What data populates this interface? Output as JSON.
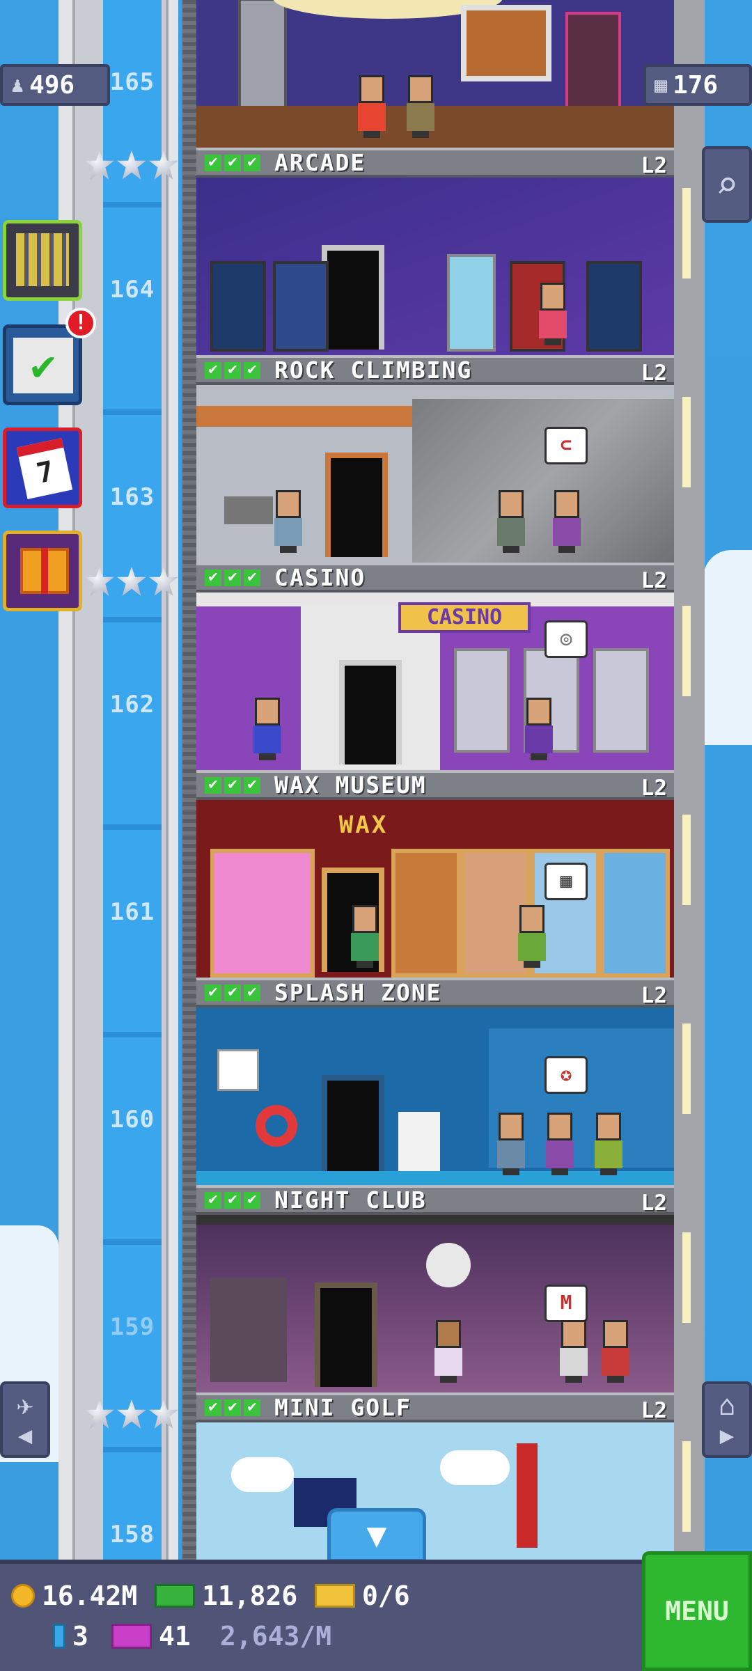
{
  "header": {
    "population": "496",
    "floors_count": "176",
    "population_icon": "person-icon",
    "floors_icon": "building-icon"
  },
  "elevator": {
    "floor_numbers": [
      "165",
      "164",
      "163",
      "162",
      "161",
      "160",
      "159",
      "158"
    ]
  },
  "floors": [
    {
      "name": "ARCADE",
      "level": "L2",
      "stars": 3
    },
    {
      "name": "ROCK CLIMBING",
      "level": "L2",
      "stars": 0
    },
    {
      "name": "CASINO",
      "level": "L2",
      "stars": 3
    },
    {
      "name": "WAX MUSEUM",
      "level": "L2",
      "stars": 0
    },
    {
      "name": "SPLASH ZONE",
      "level": "L2",
      "stars": 0
    },
    {
      "name": "NIGHT CLUB",
      "level": "L2",
      "stars": 0
    },
    {
      "name": "MINI GOLF",
      "level": "L2",
      "stars": 3
    }
  ],
  "room_signs": {
    "casino": "CASINO",
    "wax": "WAX"
  },
  "side_buttons": {
    "build_icon": "building-grid-icon",
    "missions_icon": "clipboard-check-icon",
    "missions_badge": "!",
    "calendar_icon": "calendar-icon",
    "calendar_day": "7",
    "gift_icon": "gift-icon"
  },
  "right_buttons": {
    "search_icon": "magnifier-icon",
    "home_icon": "home-next-icon",
    "prev_icon": "elevator-prev-icon"
  },
  "hud": {
    "coins": "16.42M",
    "bux": "11,826",
    "tickets": "0/6",
    "gems": "3",
    "vip": "41",
    "rate": "2,643/M",
    "menu_label": "MENU"
  },
  "colors": {
    "sky": "#3a9ee3",
    "hud": "#505578",
    "menu": "#2eb82f",
    "check": "#39c43b"
  }
}
